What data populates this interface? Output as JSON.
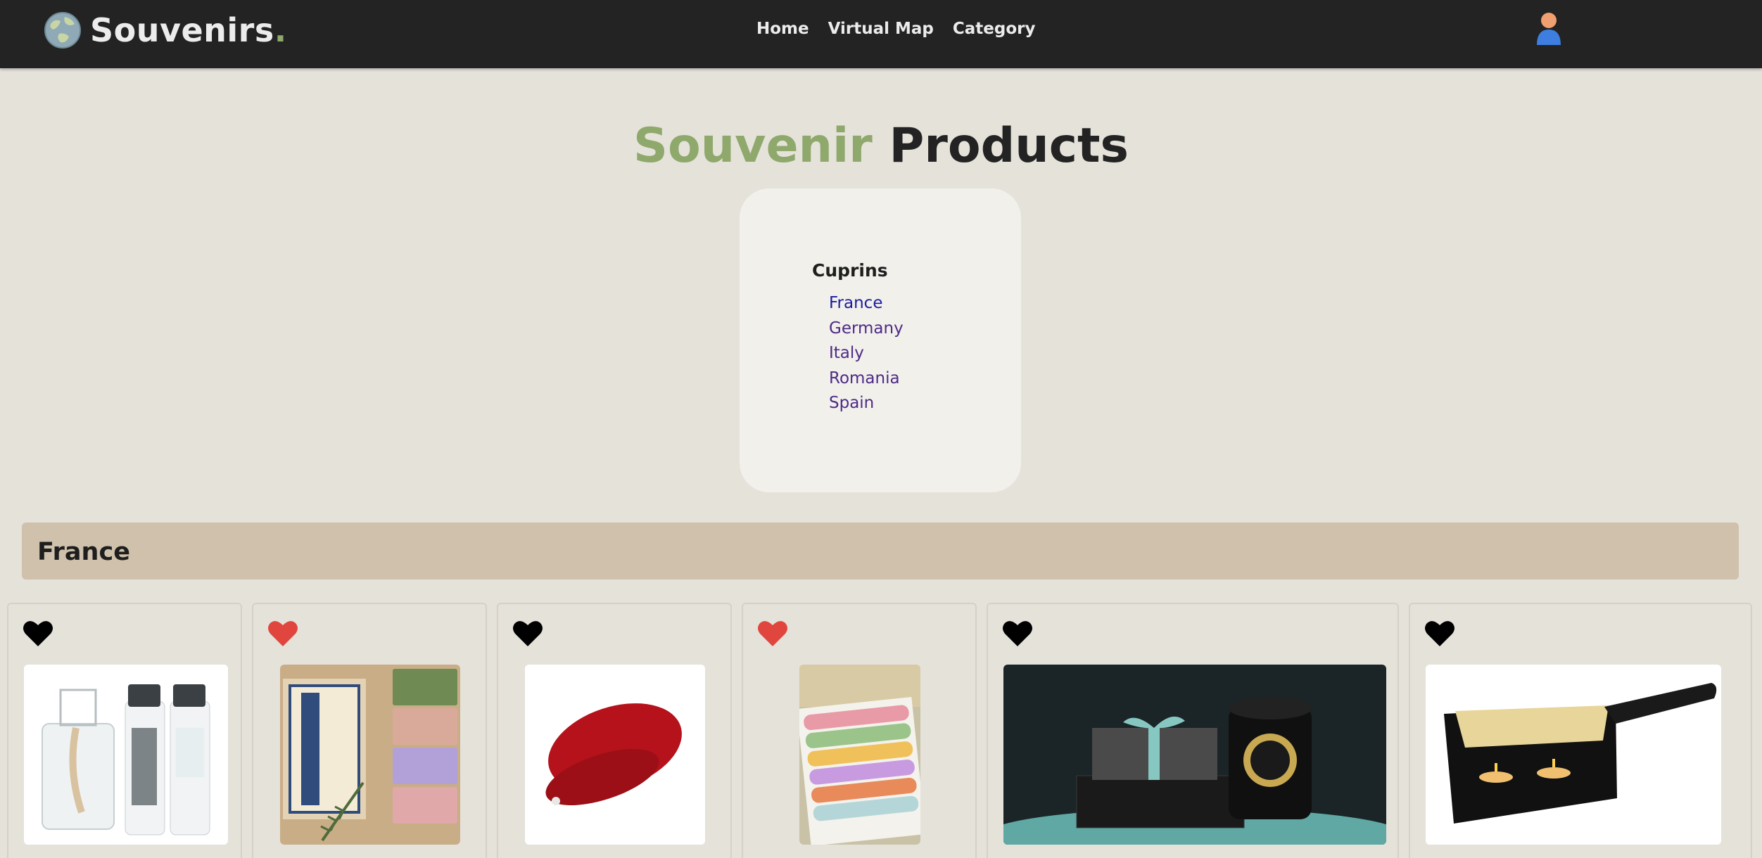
{
  "navbar": {
    "brand": "Souvenirs",
    "brand_dot": ".",
    "links": [
      "Home",
      "Virtual Map",
      "Category"
    ]
  },
  "page": {
    "title_accent": "Souvenir",
    "title_rest": "Products"
  },
  "countries": {
    "heading": "Cuprins",
    "items": [
      "France",
      "Germany",
      "Italy",
      "Romania",
      "Spain"
    ],
    "active": "France"
  },
  "section": {
    "title": "France"
  },
  "products": [
    {
      "image": "lampe-berger-bottles",
      "favorited": false
    },
    {
      "image": "savon-de-marseille-soaps",
      "favorited": true
    },
    {
      "image": "red-beret",
      "favorited": false
    },
    {
      "image": "macarons-box",
      "favorited": true
    },
    {
      "image": "marco-polo-tea-gift",
      "favorited": false
    },
    {
      "image": "raclette-grill-pan",
      "favorited": false
    }
  ],
  "colors": {
    "navbar_bg": "#232323",
    "page_bg": "#e5e2da",
    "accent_green": "#8fa86b",
    "section_bg": "#cfc1ab",
    "heart_active": "#e0463d",
    "heart_inactive": "#000000"
  }
}
